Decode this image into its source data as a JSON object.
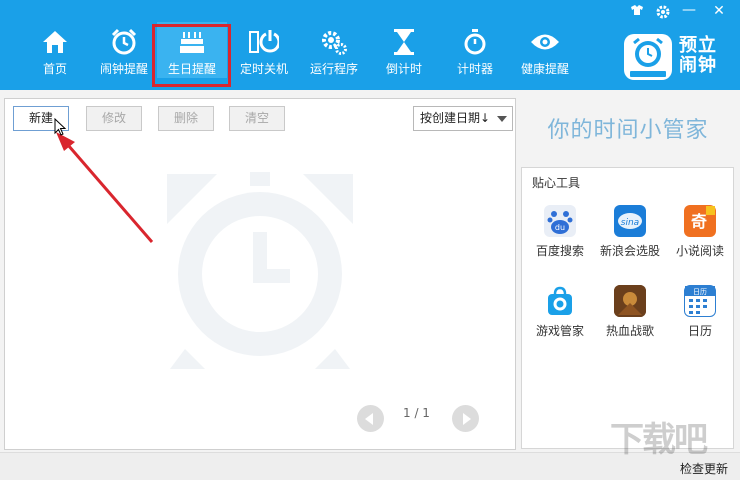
{
  "nav": {
    "items": [
      {
        "label": "首页",
        "icon": "home-icon"
      },
      {
        "label": "闹钟提醒",
        "icon": "alarm-clock-icon"
      },
      {
        "label": "生日提醒",
        "icon": "birthday-cake-icon"
      },
      {
        "label": "定时关机",
        "icon": "power-icon"
      },
      {
        "label": "运行程序",
        "icon": "gears-icon"
      },
      {
        "label": "倒计时",
        "icon": "hourglass-icon"
      },
      {
        "label": "计时器",
        "icon": "stopwatch-icon"
      },
      {
        "label": "健康提醒",
        "icon": "eye-icon"
      }
    ],
    "active_index": 2
  },
  "window_controls": {
    "skin_icon": "shirt-icon",
    "settings_icon": "gear-icon",
    "minimize": "—",
    "close": "✕"
  },
  "logo": {
    "title_line1": "预立",
    "title_line2": "闹钟",
    "badge": "预立闹钟"
  },
  "toolbar": {
    "new_label": "新建",
    "edit_label": "修改",
    "delete_label": "删除",
    "clear_label": "清空",
    "sort_label": "按创建日期↓"
  },
  "pager": {
    "text": "1 / 1"
  },
  "sidebar": {
    "slogan": "你的时间小管家",
    "tools_title": "贴心工具",
    "tools": [
      {
        "label": "百度搜索",
        "icon": "baidu-icon",
        "color": "#2f6fd6"
      },
      {
        "label": "新浪会选股",
        "icon": "sina-icon",
        "color": "#1b7dd8"
      },
      {
        "label": "小说阅读",
        "icon": "novel-icon",
        "color": "#f07020"
      },
      {
        "label": "游戏管家",
        "icon": "game-bag-icon",
        "color": "#1aa0e8"
      },
      {
        "label": "热血战歌",
        "icon": "warrior-game-icon",
        "color": "#7a4a22"
      },
      {
        "label": "日历",
        "icon": "calendar-icon",
        "color": "#2d7fd2"
      }
    ]
  },
  "statusbar": {
    "check_update": "检查更新"
  },
  "watermark_text": "下载吧",
  "colors": {
    "topbar": "#1aa0e8",
    "highlight_frame": "#d9262e",
    "annotation_arrow": "#d9262e",
    "slogan": "#7fb6da"
  }
}
